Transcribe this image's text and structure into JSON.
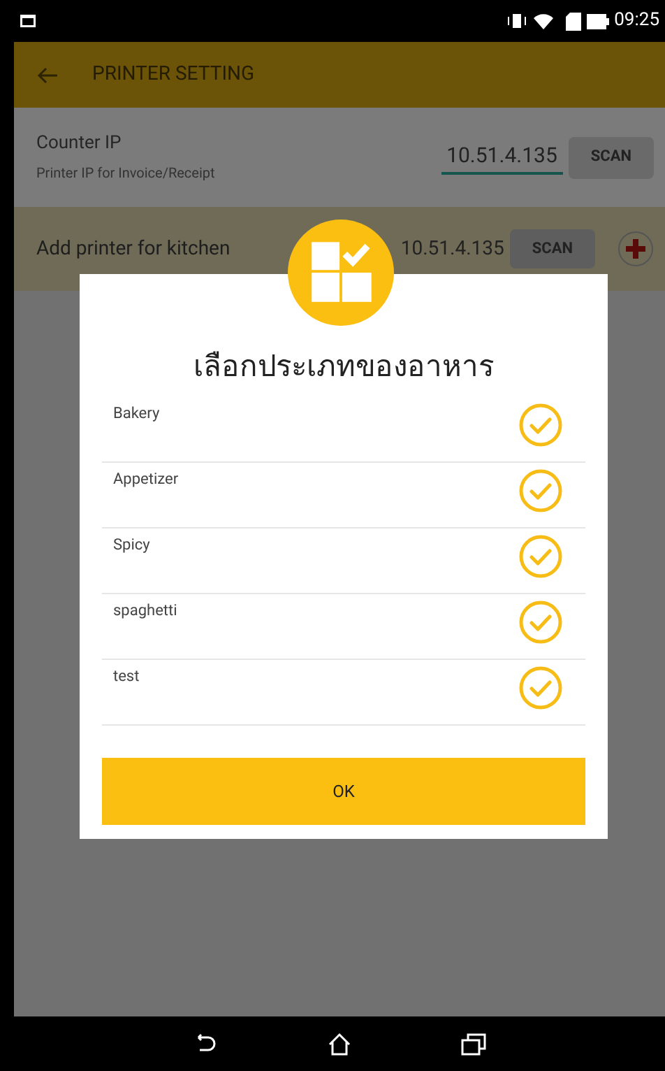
{
  "status_bar": {
    "time": "09:25"
  },
  "app_bar": {
    "title": "PRINTER SETTING"
  },
  "counter": {
    "label": "Counter IP",
    "hint": "Printer IP for Invoice/Receipt",
    "ip": "10.51.4.135",
    "button": "SCAN"
  },
  "kitchen": {
    "label": "Add printer for kitchen",
    "ip": "10.51.4.135",
    "button": "SCAN"
  },
  "dialog": {
    "title": "เลือกประเภทของอาหาร",
    "items": [
      {
        "label": "Bakery",
        "checked": true
      },
      {
        "label": "Appetizer",
        "checked": true
      },
      {
        "label": "Spicy",
        "checked": true
      },
      {
        "label": "spaghetti",
        "checked": true
      },
      {
        "label": "test",
        "checked": true
      }
    ],
    "ok": "OK"
  }
}
